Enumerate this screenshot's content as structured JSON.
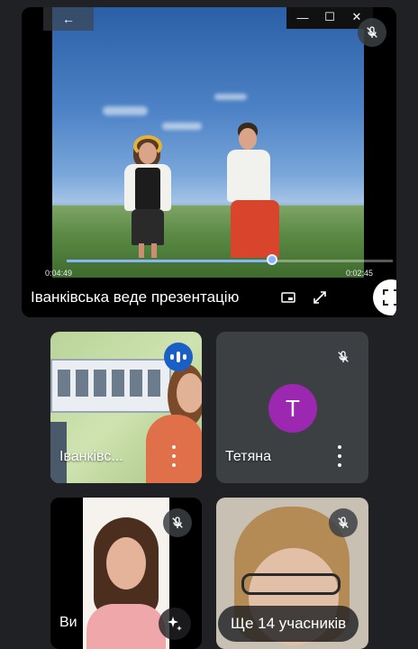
{
  "presentation": {
    "presenter_label": "Іванківська веде презентацію",
    "time_elapsed": "0:04:49",
    "time_remaining": "0:02:45",
    "progress": 0.63,
    "window_controls": {
      "back": "←",
      "minimize": "—",
      "maximize": "☐",
      "close": "✕"
    }
  },
  "participants": [
    {
      "name": "Іванківс...",
      "speaking": true
    },
    {
      "name": "Тетяна",
      "avatar_letter": "T",
      "avatar_color": "#9c27b0",
      "muted": true
    },
    {
      "name": "Ви",
      "muted": true
    },
    {
      "label": "Ще 14 учасників",
      "muted": true
    }
  ],
  "colors": {
    "background": "#202124",
    "accent": "#8ab4f8",
    "speaking": "#1a5fc5"
  }
}
